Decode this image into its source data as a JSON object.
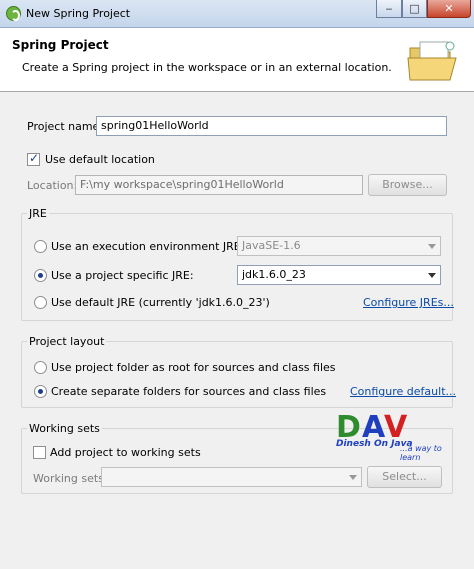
{
  "window": {
    "title": "New Spring Project",
    "buttons": {
      "minimize": "‒",
      "maximize": "□",
      "close": "✕"
    }
  },
  "banner": {
    "heading": "Spring Project",
    "description": "Create a Spring project in the workspace or in an external location."
  },
  "project": {
    "name_label": "Project name:",
    "name_value": "spring01HelloWorld",
    "use_default_location_label": "Use default location",
    "use_default_location_checked": true,
    "location_label": "Location:",
    "location_value": "F:\\my workspace\\spring01HelloWorld",
    "browse_label": "Browse..."
  },
  "jre": {
    "group_label": "JRE",
    "options": [
      {
        "label": "Use an execution environment JRE:",
        "selected": false,
        "combo": "JavaSE-1.6",
        "enabled": false
      },
      {
        "label": "Use a project specific JRE:",
        "selected": true,
        "combo": "jdk1.6.0_23",
        "enabled": true
      },
      {
        "label": "Use default JRE (currently 'jdk1.6.0_23')",
        "selected": false
      }
    ],
    "configure_link": "Configure JREs..."
  },
  "layout": {
    "group_label": "Project layout",
    "options": [
      {
        "label": "Use project folder as root for sources and class files",
        "selected": false
      },
      {
        "label": "Create separate folders for sources and class files",
        "selected": true
      }
    ],
    "configure_link": "Configure default..."
  },
  "working_sets": {
    "group_label": "Working sets",
    "add_label": "Add project to working sets",
    "add_checked": false,
    "sets_label": "Working sets:",
    "select_label": "Select..."
  },
  "watermark": {
    "logo": "DAV",
    "caption": "Dinesh On Java",
    "tagline": "...a way to learn",
    "colors": [
      "#2e8b2e",
      "#1f3fbf",
      "#d42020"
    ]
  }
}
